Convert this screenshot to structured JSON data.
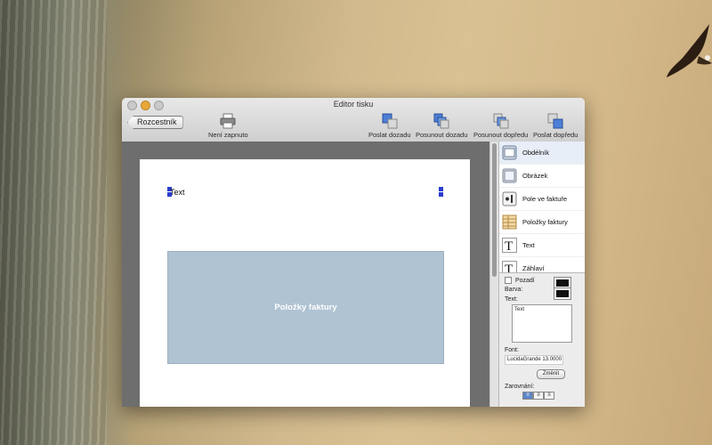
{
  "window": {
    "title": "Editor tisku"
  },
  "toolbar": {
    "back_label": "Rozcestník",
    "printer_label": "Není zapnuto",
    "send_back_label": "Poslat dozadu",
    "move_back_label": "Posunout dozadu",
    "move_forward_label": "Posunout dopředu",
    "send_front_label": "Poslat dopředu"
  },
  "canvas": {
    "text_element": "Text",
    "block_label": "Položky faktury"
  },
  "tools": [
    {
      "label": "Obdélník",
      "icon": "rectangle-icon"
    },
    {
      "label": "Obrázek",
      "icon": "image-icon"
    },
    {
      "label": "Pole ve faktuře",
      "icon": "invoice-field-icon"
    },
    {
      "label": "Položky faktury",
      "icon": "invoice-items-icon"
    },
    {
      "label": "Text",
      "icon": "text-icon"
    },
    {
      "label": "Záhlaví",
      "icon": "header-icon"
    }
  ],
  "props": {
    "background_label": "Pozadí",
    "color_label": "Barva:",
    "text_label": "Text:",
    "text_value": "Text",
    "font_label": "Font:",
    "font_value": "LucidaGrande 13.0000",
    "change_label": "Změnit",
    "alignment_label": "Zarovnání:"
  },
  "colors": {
    "accent": "#2a3ccf",
    "block": "#b0c3d3",
    "swatch": "#111111"
  }
}
